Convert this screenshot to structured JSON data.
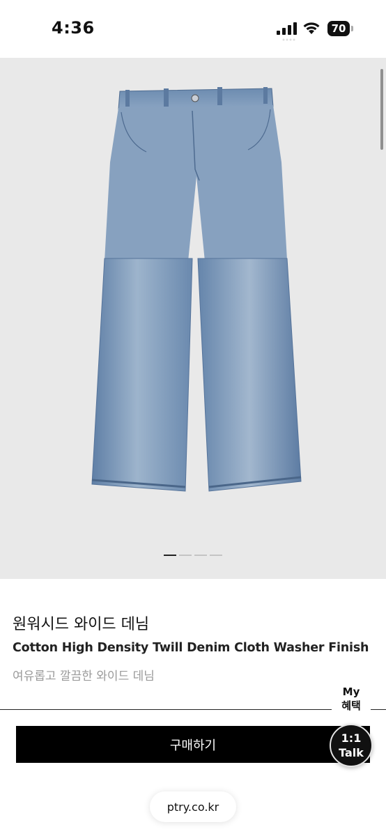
{
  "status_bar": {
    "time": "4:36",
    "battery_level": "70",
    "icons": [
      "signal-icon",
      "wifi-icon",
      "battery-icon"
    ]
  },
  "gallery": {
    "image_subject": "jeans",
    "denim_color": "#6f8fb3",
    "background_color": "#e9e9e9",
    "image_count": 4,
    "active_index": 0
  },
  "product": {
    "name": "원워시드 와이드 데님",
    "subtitle": "Cotton High Density Twill Denim Cloth Washer Finish",
    "description": "여유롭고 깔끔한 와이드 데님"
  },
  "floating": {
    "my_benefit_line1": "My",
    "my_benefit_line2": "혜택",
    "talk_line1": "1:1",
    "talk_line2": "Talk"
  },
  "actions": {
    "buy_label": "구매하기"
  },
  "browser": {
    "url": "ptry.co.kr"
  }
}
